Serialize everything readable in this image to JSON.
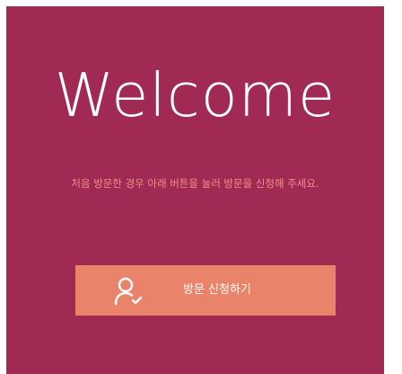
{
  "welcome": {
    "title": "Welcome",
    "description": "처음 방문한 경우 아래 버튼을 눌러 방문을 신청해 주세요."
  },
  "visit_button": {
    "label": "방문 신청하기",
    "icon": "user-check-icon"
  },
  "colors": {
    "panel_background": "#a12a54",
    "button_background": "#e9846a",
    "description_text": "#ec9088",
    "title_text": "#ffffff"
  }
}
